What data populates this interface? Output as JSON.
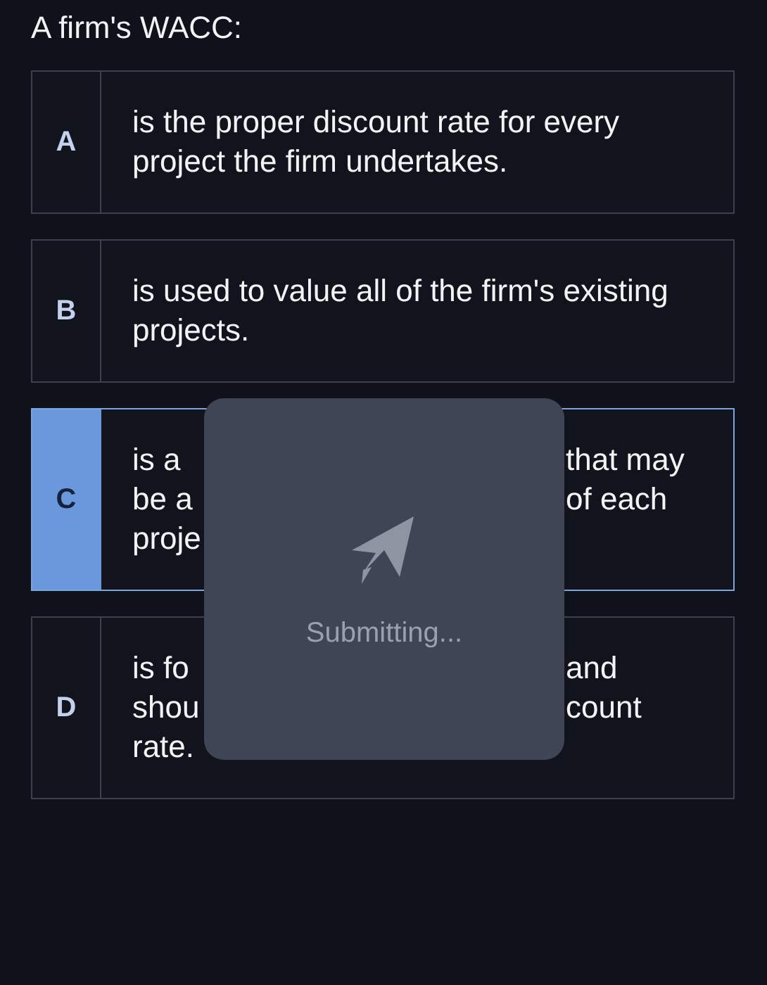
{
  "question": "A firm's WACC:",
  "options": [
    {
      "letter": "A",
      "selected": false,
      "kind": "full",
      "text": "is the proper discount rate for every project the firm undertakes."
    },
    {
      "letter": "B",
      "selected": false,
      "kind": "full",
      "text": "is used to value all of the firm's existing projects."
    },
    {
      "letter": "C",
      "selected": true,
      "kind": "partial",
      "lines": [
        {
          "left": "is a",
          "right": "that may"
        },
        {
          "left": "be a",
          "right": "of each"
        },
        {
          "left": "proje"
        }
      ]
    },
    {
      "letter": "D",
      "selected": false,
      "kind": "partial",
      "lines": [
        {
          "left": "is fo",
          "right": "and"
        },
        {
          "left": "shou",
          "right": "count"
        },
        {
          "left": "rate."
        }
      ]
    }
  ],
  "overlay": {
    "message": "Submitting..."
  }
}
